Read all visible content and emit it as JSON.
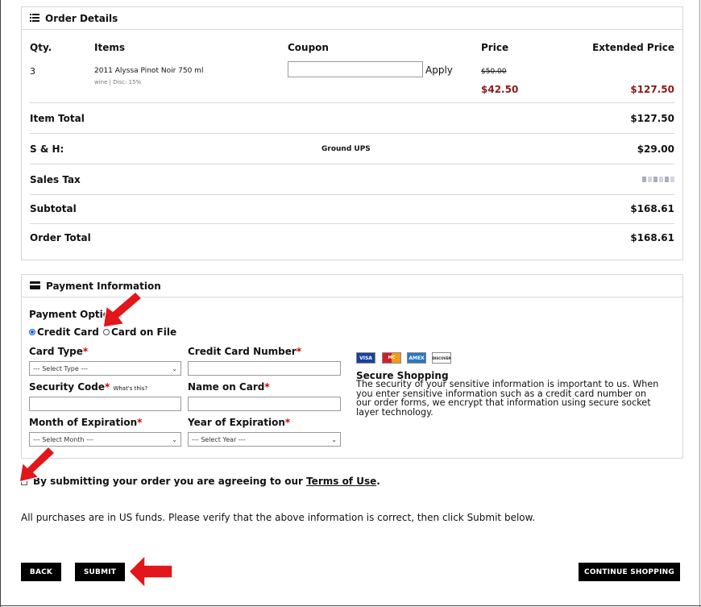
{
  "order": {
    "title": "Order Details",
    "headers": {
      "qty": "Qty.",
      "items": "Items",
      "coupon": "Coupon",
      "price": "Price",
      "extended": "Extended Price"
    },
    "line": {
      "qty": "3",
      "item_name": "2011 Alyssa Pinot Noir 750 ml",
      "item_meta": "wine | Disc: 15%",
      "coupon_value": "",
      "apply_label": "Apply",
      "original_price": "$50.00",
      "price": "$42.50",
      "extended": "$127.50"
    },
    "summary": {
      "item_total_label": "Item Total",
      "item_total": "$127.50",
      "sh_label": "S & H:",
      "sh_method": "Ground UPS",
      "sh_value": "$29.00",
      "sales_tax_label": "Sales Tax",
      "subtotal_label": "Subtotal",
      "subtotal": "$168.61",
      "order_total_label": "Order Total",
      "order_total": "$168.61"
    }
  },
  "payment": {
    "title": "Payment Information",
    "options_label": "Payment Options",
    "options": [
      "Credit Card",
      "Card on File"
    ],
    "selected_option": "Credit Card",
    "card_type_label": "Card Type",
    "card_type_value": "--- Select Type ---",
    "card_number_label": "Credit Card Number",
    "security_code_label": "Security Code",
    "whats_this": "What's this?",
    "name_on_card_label": "Name on Card",
    "month_label": "Month of Expiration",
    "month_value": "--- Select Month ---",
    "year_label": "Year of Expiration",
    "year_value": "--- Select Year ---",
    "card_logos": [
      "VISA",
      "MC",
      "AMEX",
      "DISCOVER"
    ],
    "secure_title": "Secure Shopping",
    "secure_text": "The security of your sensitive information is important to us. When you enter sensitive information such as a credit card number on our order forms, we encrypt that information using secure socket layer technology."
  },
  "terms": {
    "text": "By submitting your order you are agreeing to our ",
    "link": "Terms of Use",
    "period": "."
  },
  "notice": "All purchases are in US funds. Please verify that the above information is correct, then click Submit below.",
  "buttons": {
    "back": "BACK",
    "submit": "SUBMIT",
    "continue": "CONTINUE SHOPPING"
  },
  "colors": {
    "accent": "#8b1a1a",
    "required": "#cc0000",
    "arrow": "#e3161b",
    "button": "#000000"
  }
}
